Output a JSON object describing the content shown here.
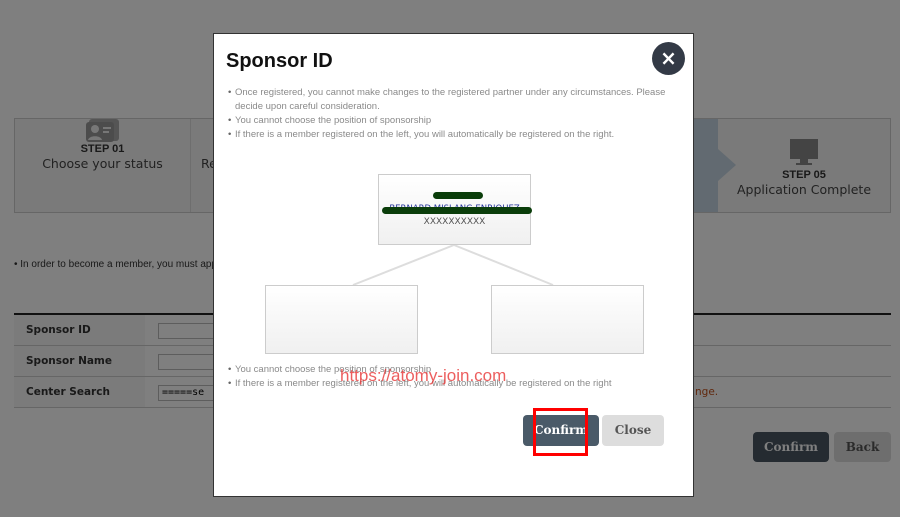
{
  "page": {
    "steps": [
      {
        "num": "STEP 01",
        "label": "Choose your status",
        "icon": "id-card-icon"
      },
      {
        "num": "",
        "label": "Re"
      },
      {
        "num": "STEP 05",
        "label": "Application Complete",
        "icon": "monitor-icon"
      }
    ],
    "intro": "In order to become a member, you must appo",
    "form": {
      "sponsor_id_label": "Sponsor ID",
      "sponsor_name_label": "Sponsor Name",
      "center_search_label": "Center Search",
      "center_search_value": "=====se",
      "warning_fragment": "nge."
    },
    "confirm_label": "Confirm",
    "back_label": "Back"
  },
  "modal": {
    "title": "Sponsor ID",
    "close_icon": "×",
    "notes": [
      "Once registered, you cannot make changes to the registered partner under any circumstances. Please decide upon careful consideration.",
      "You cannot choose the position of sponsorship",
      "If there is a member registered on the left, you will automatically be registered on the right."
    ],
    "tree": {
      "sponsor_name": "BERNARD MISLANG ENRIQUEZ",
      "sponsor_id": "XXXXXXXXXX"
    },
    "notes_bottom": [
      "You cannot choose the position of sponsorship",
      "If there is a member registered on the left, you will automatically be registered on the right"
    ],
    "watermark": "https://atomy-join.com",
    "confirm_label": "Confirm",
    "close_label": "Close",
    "highlight_color": "#ff0000"
  }
}
